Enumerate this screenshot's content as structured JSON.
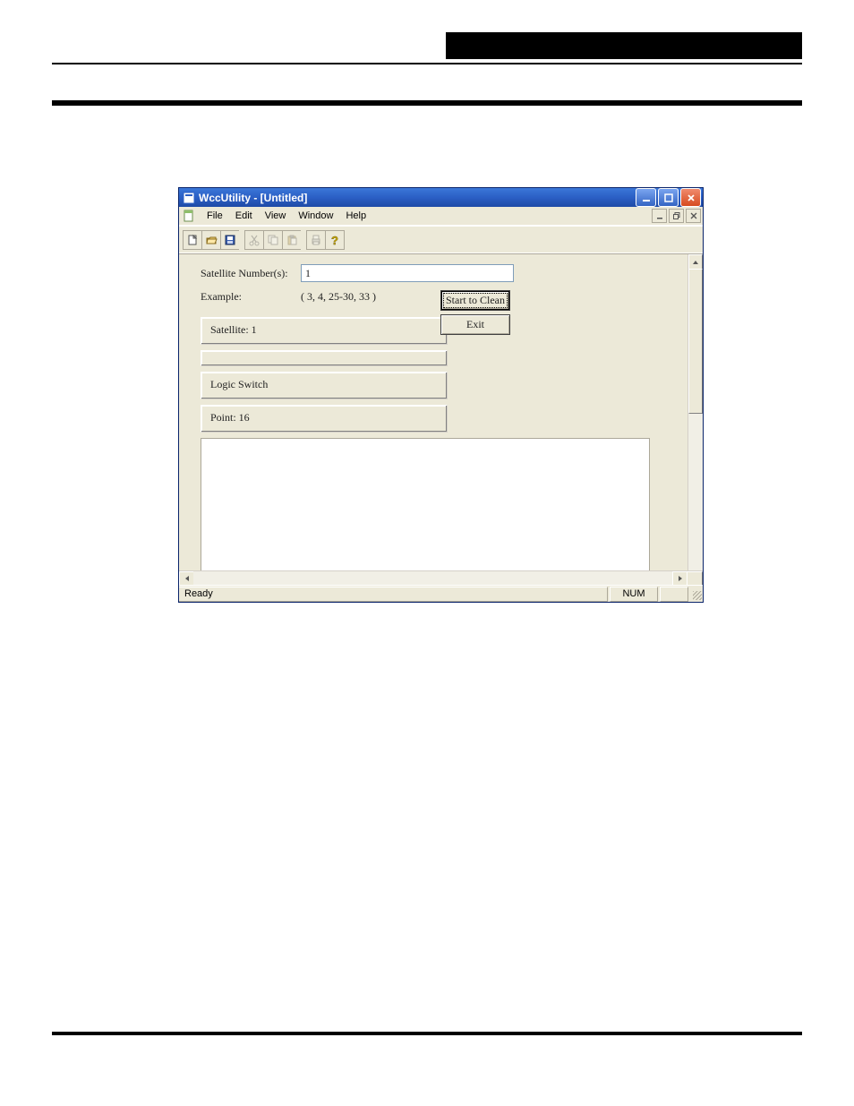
{
  "window": {
    "app_name": "WccUtility",
    "doc_name": "[Untitled]",
    "title": "WccUtility - [Untitled]"
  },
  "menu": {
    "file": "File",
    "edit": "Edit",
    "view": "View",
    "window": "Window",
    "help": "Help"
  },
  "toolbar": {
    "new": "new-icon",
    "open": "open-icon",
    "save": "save-icon",
    "cut": "cut-icon",
    "copy": "copy-icon",
    "paste": "paste-icon",
    "print": "print-icon",
    "help": "help-icon"
  },
  "form": {
    "sat_label": "Satellite Number(s):",
    "sat_value": "1",
    "example_label": "Example:",
    "example_value": "( 3, 4, 25-30, 33 )",
    "start_btn": "Start to Clean",
    "exit_btn": "Exit",
    "group_satellite": "Satellite: 1",
    "group_logic": "Logic Switch",
    "group_point": "Point: 16"
  },
  "status": {
    "ready": "Ready",
    "num": "NUM"
  }
}
